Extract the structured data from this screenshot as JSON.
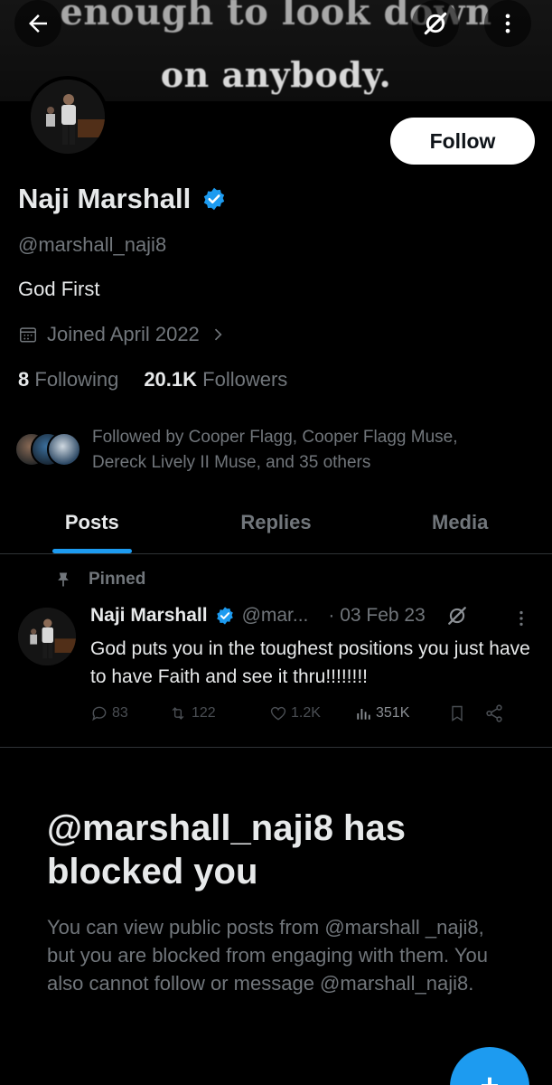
{
  "banner": {
    "line1": "enough to look down",
    "line2": "on anybody."
  },
  "header": {
    "back_icon": "arrow-left-icon",
    "grok_icon": "grok-icon",
    "more_icon": "more-vertical-icon"
  },
  "profile": {
    "follow_label": "Follow",
    "display_name": "Naji Marshall",
    "handle": "@marshall_naji8",
    "bio": "God First",
    "joined": "Joined April 2022",
    "following_count": "8",
    "following_label": "Following",
    "followers_count": "20.1K",
    "followers_label": "Followers",
    "followed_by": "Followed by Cooper Flagg, Cooper Flagg Muse, Dereck Lively II Muse, and 35 others"
  },
  "tabs": [
    {
      "label": "Posts",
      "active": true
    },
    {
      "label": "Replies",
      "active": false
    },
    {
      "label": "Media",
      "active": false
    }
  ],
  "post": {
    "pinned_label": "Pinned",
    "name": "Naji Marshall",
    "handle": "@mar...",
    "date": "· 03 Feb 23",
    "text": "God puts you in the toughest positions you just have to have Faith and see it thru!!!!!!!!",
    "replies": "83",
    "reposts": "122",
    "likes": "1.2K",
    "views": "351K"
  },
  "blocked": {
    "title": "@marshall_naji8 has blocked you",
    "body": "You can view public posts from @marshall _naji8, but you are blocked from engaging with them. You also cannot follow or message @marshall_naji8."
  },
  "fab": {
    "label": "+"
  },
  "colors": {
    "accent": "#1d9bf0",
    "background": "#000000",
    "text_primary": "#e7e9ea",
    "text_secondary": "#71767b"
  }
}
